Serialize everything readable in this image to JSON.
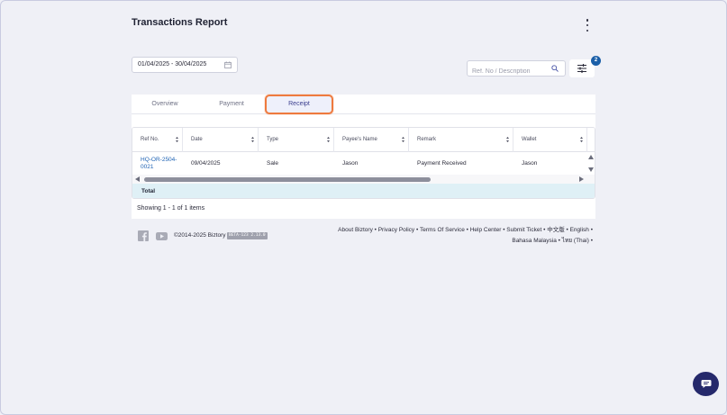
{
  "header": {
    "title": "Transactions Report"
  },
  "filters": {
    "date_range": "01/04/2025 - 30/04/2025",
    "search_placeholder": "Ref. No / Description",
    "filter_count": "2"
  },
  "tabs": [
    {
      "label": "Overview"
    },
    {
      "label": "Payment"
    },
    {
      "label": "Receipt"
    }
  ],
  "table": {
    "columns": [
      "Ref No.",
      "Date",
      "Type",
      "Payee's Name",
      "Remark",
      "Wallet"
    ],
    "rows": [
      {
        "ref": "HQ-OR-2504-0021",
        "date": "09/04/2025",
        "type": "Sale",
        "payee": "Jason",
        "remark": "Payment Received",
        "wallet": "Jason"
      }
    ],
    "total_label": "Total",
    "showing": "Showing 1 - 1 of 1 items"
  },
  "footer": {
    "copyright": "©2014-2025 Biztory",
    "version": "BETA-123 2.13.0",
    "links": [
      "About Biztory",
      "Privacy Policy",
      "Terms Of Service",
      "Help Center",
      "Submit Ticket",
      "中文版",
      "English",
      "Bahasa Malaysia",
      "ไทย (Thai)"
    ]
  },
  "colors": {
    "accent": "#ee7a3e",
    "primary": "#25296b",
    "link": "#1e62b4"
  }
}
